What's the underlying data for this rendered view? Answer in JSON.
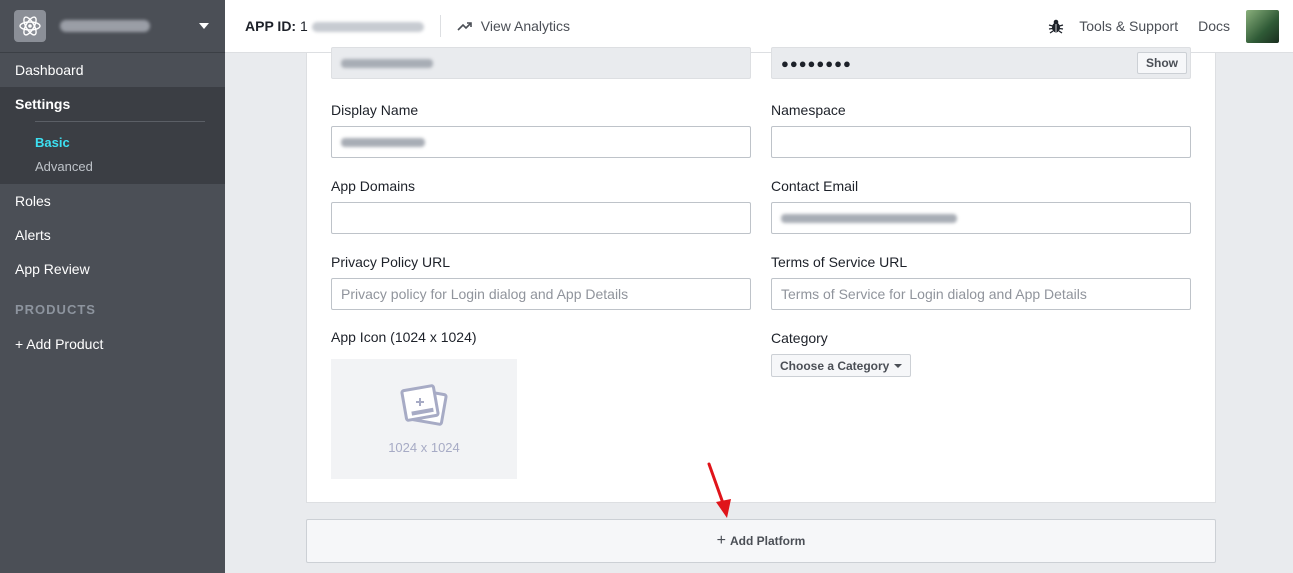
{
  "sidebar": {
    "app_logo_icon": "atom-icon",
    "nav": {
      "dashboard": "Dashboard",
      "settings": "Settings",
      "basic": "Basic",
      "advanced": "Advanced",
      "roles": "Roles",
      "alerts": "Alerts",
      "app_review": "App Review"
    },
    "products_heading": "PRODUCTS",
    "add_product": "+ Add Product"
  },
  "topbar": {
    "app_id_label": "APP ID:",
    "app_id_first_char": "1",
    "view_analytics": "View Analytics",
    "tools_support": "Tools & Support",
    "docs": "Docs"
  },
  "form": {
    "secret_value": "●●●●●●●●",
    "show_button": "Show",
    "display_name_label": "Display Name",
    "namespace_label": "Namespace",
    "app_domains_label": "App Domains",
    "contact_email_label": "Contact Email",
    "privacy_label": "Privacy Policy URL",
    "privacy_placeholder": "Privacy policy for Login dialog and App Details",
    "terms_label": "Terms of Service URL",
    "terms_placeholder": "Terms of Service for Login dialog and App Details",
    "app_icon_label": "App Icon (1024 x 1024)",
    "app_icon_size": "1024 x 1024",
    "category_label": "Category",
    "category_button": "Choose a Category"
  },
  "add_platform": {
    "plus": "+",
    "label": "Add Platform"
  },
  "colors": {
    "sidebar_bg": "#4b4f56",
    "active_sub": "#3ce0f2",
    "annotation_arrow": "#e0141a"
  }
}
